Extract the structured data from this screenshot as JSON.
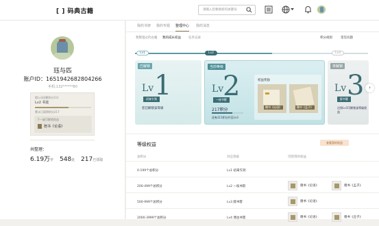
{
  "header": {
    "logo": "[ ] 码典古籍",
    "search_placeholder": "请输入您要搜索的关键词"
  },
  "profile": {
    "name": "珏与匹",
    "account_id": "账户ID：1651942682804266",
    "phone": "手机:132******80",
    "level_hint": "距Lv3还需积分111",
    "level_label": "Lv2 书友",
    "progress": 0.6,
    "level_sub": "累计已获得积分217",
    "next_hint": "下一级可解锁权益",
    "next_reward": "赠书《论语》",
    "stats_label": "共整理：",
    "stats": [
      {
        "value": "6.19万",
        "unit": "字"
      },
      {
        "value": "548",
        "unit": "处"
      },
      {
        "value": "217",
        "unit": "已领取"
      }
    ]
  },
  "tabs_top": [
    "我的书架",
    "我的专题",
    "整理中心",
    "我的消息"
  ],
  "tabs_top_active": 2,
  "tabs_sub": [
    "我整理过的古籍",
    "我的成长权益",
    "任务记录"
  ],
  "tabs_sub_active": 1,
  "right_links": [
    "积分规则",
    "常见问题"
  ],
  "levels": [
    {
      "pill": "Lv1",
      "tag": "已解锁",
      "lv_text": "Lv",
      "num": "1",
      "ribbon": "初来乍到",
      "desc": "您已解锁该等级"
    },
    {
      "pill": "Lv2",
      "tag": "当前等级",
      "lv_text": "Lv",
      "num": "2",
      "ribbon": "一枝书影",
      "desc": "217积分",
      "desc2": "还有111积分升至Lv3",
      "rewards_title": "权益奖励",
      "rewards": [
        "赠书《论语》",
        "赠书《孟子》"
      ]
    },
    {
      "pill": "Lv3",
      "tag": "未解锁",
      "lv_text": "Lv",
      "num": "3",
      "ribbon": "醉书客",
      "desc": "达到Lv3可解锁该等级权益"
    }
  ],
  "section": {
    "title": "等级权益",
    "button": "查看我的权益"
  },
  "table": {
    "headers": [
      "总积分",
      "对应等级",
      "可获得的权益"
    ],
    "rows": [
      {
        "points": "0-199个总积分",
        "level": "Lv1 初来乍到",
        "rewards": []
      },
      {
        "points": "200-499个总积分",
        "level": "Lv2 一枝书影",
        "rewards": [
          "赠书《论语》",
          "赠书《孟子》"
        ]
      },
      {
        "points": "500-999个总积分",
        "level": "Lv3 醉书客",
        "rewards": [
          "赠书《论语》"
        ]
      },
      {
        "points": "2000-3999个总积分",
        "level": "Lv4 博古书客",
        "rewards": [
          "赠书《论语》",
          "赠书《庄子》"
        ]
      }
    ]
  }
}
